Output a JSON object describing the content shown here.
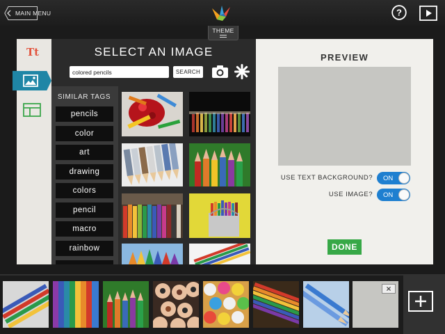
{
  "topbar": {
    "main_menu_label": "MAIN MENU",
    "theme_label": "THEME",
    "icons": [
      "back-arrow-icon",
      "bird-logo-icon",
      "help-icon",
      "play-icon"
    ]
  },
  "sidebar": {
    "text_tool_label": "Tt",
    "icons": [
      "image-icon",
      "layout-icon"
    ]
  },
  "select_image": {
    "title": "SELECT AN IMAGE",
    "search_value": "colored pencils",
    "search_button": "SEARCH",
    "icons": [
      "camera-icon",
      "asterisk-icon"
    ]
  },
  "similar_tags": {
    "header": "SIMILAR TAGS",
    "items": [
      "pencils",
      "color",
      "art",
      "drawing",
      "colors",
      "pencil",
      "macro",
      "rainbow"
    ]
  },
  "preview": {
    "title": "PREVIEW",
    "text_background_label": "USE TEXT BACKGROUND?",
    "text_background_state": "ON",
    "use_image_label": "USE IMAGE?",
    "use_image_state": "ON",
    "done_label": "DONE"
  },
  "colors": {
    "accent_blue": "#1e7fd0",
    "rail_tab": "#1f86a6",
    "done_green": "#37a847",
    "text_icon_red": "#e2543e",
    "layout_icon_green": "#3aa54a"
  }
}
